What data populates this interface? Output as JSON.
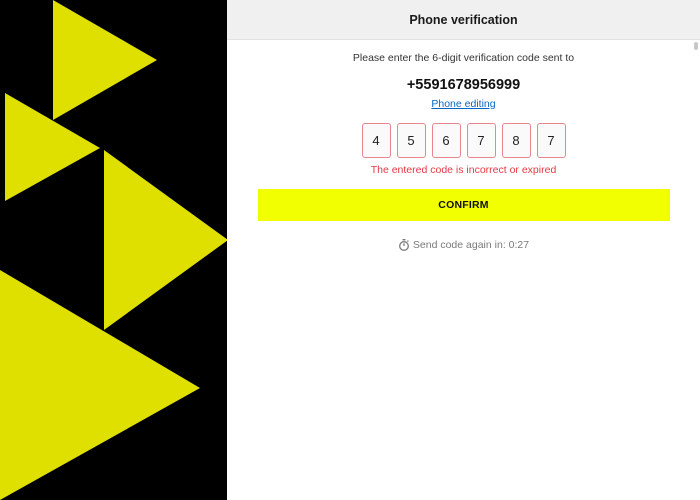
{
  "colors": {
    "left_background": "#000000",
    "triangle": "#e0e000",
    "header_background": "#f0f0f0",
    "confirm_button": "#f2ff00",
    "error": "#e53946",
    "link": "#0a66c2",
    "digit_border": "#e8868e"
  },
  "header": {
    "title": "Phone verification"
  },
  "verification": {
    "instruction": "Please enter the 6-digit verification code sent to",
    "phone_number": "+5591678956999",
    "edit_link": "Phone editing",
    "code_digits": [
      "4",
      "5",
      "6",
      "7",
      "8",
      "7"
    ],
    "error_message": "The entered code is incorrect or expired",
    "confirm_label": "CONFIRM",
    "resend_text": "Send code again in: 0:27",
    "timer_icon": "stopwatch-icon"
  }
}
